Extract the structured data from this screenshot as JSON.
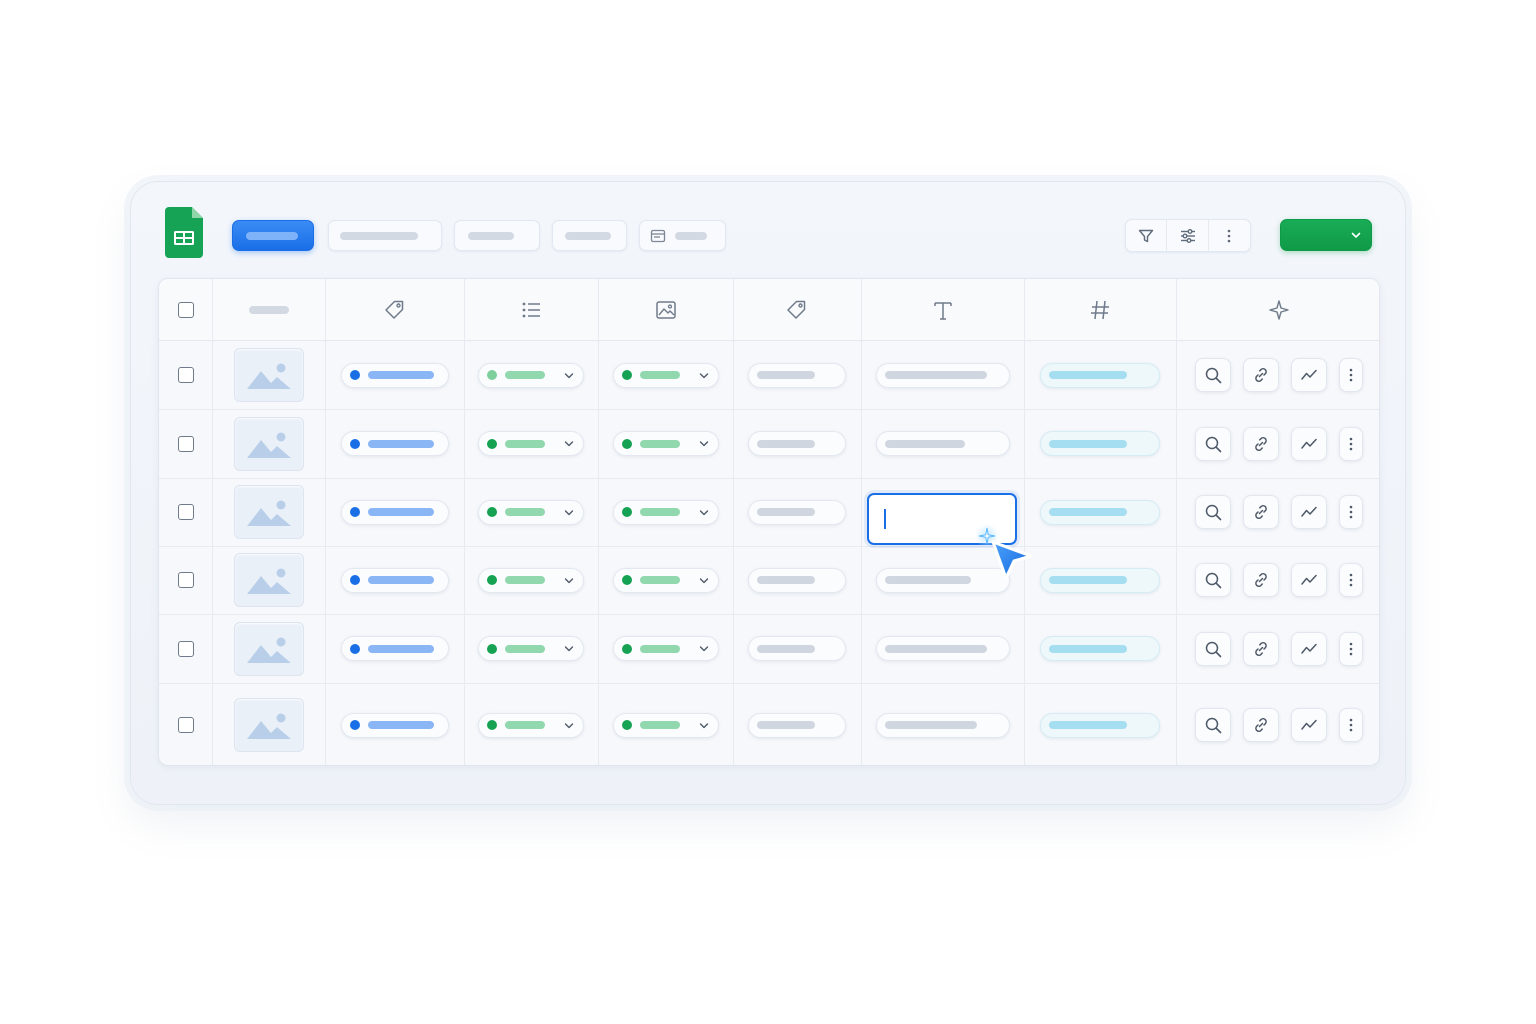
{
  "app": {
    "logo_icon": "sheets-logo-icon"
  },
  "toolbar": {
    "chips": [
      "primary-tab",
      "tab-2",
      "tab-3",
      "tab-4",
      "tab-5-with-icon"
    ],
    "icons": [
      "filter-icon",
      "sliders-icon",
      "more-vertical-icon"
    ],
    "primary_button_label": ""
  },
  "table": {
    "header_icons": [
      "tag-icon",
      "list-icon",
      "image-icon",
      "tag-icon",
      "text-icon",
      "hash-icon",
      "sparkle-icon"
    ],
    "row_count": 6,
    "row_actions": [
      "search-icon",
      "link-icon",
      "trend-icon",
      "more-vertical-icon"
    ]
  },
  "colors": {
    "accent_blue": "#1a6fe6",
    "status_green": "#15a253",
    "brand_green": "#0f9a48"
  }
}
